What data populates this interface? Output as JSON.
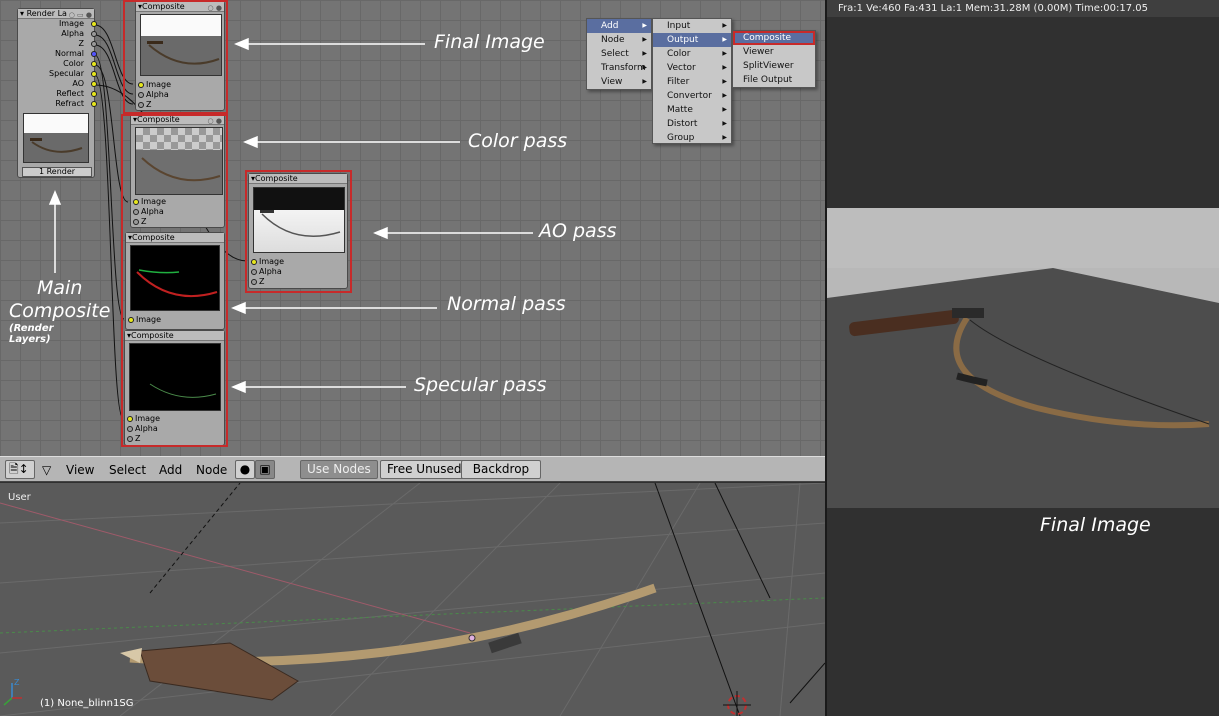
{
  "nodes": {
    "render_layers": {
      "title": "Render La",
      "outputs": [
        "Image",
        "Alpha",
        "Z",
        "Normal",
        "Color",
        "Specular",
        "AO",
        "Reflect",
        "Refract"
      ],
      "layer": "1 Render"
    },
    "composite_title": "Composite",
    "composite_inputs": [
      "Image",
      "Alpha",
      "Z"
    ]
  },
  "annotations": {
    "final_image": "Final Image",
    "color_pass": "Color pass",
    "ao_pass": "AO pass",
    "normal_pass": "Normal pass",
    "specular_pass": "Specular pass",
    "main_composite_1": "Main",
    "main_composite_2": "Composite",
    "render_layers_1": "(Render",
    "render_layers_2": "Layers)"
  },
  "menus": {
    "main": [
      "Add",
      "Node",
      "Select",
      "Transform",
      "View"
    ],
    "add": [
      "Input",
      "Output",
      "Color",
      "Vector",
      "Filter",
      "Convertor",
      "Matte",
      "Distort",
      "Group"
    ],
    "output": [
      "Composite",
      "Viewer",
      "SplitViewer",
      "File Output"
    ]
  },
  "toolbar": {
    "view": "View",
    "select": "Select",
    "add": "Add",
    "node": "Node",
    "use_nodes": "Use Nodes",
    "free_unused": "Free Unused",
    "backdrop": "Backdrop"
  },
  "viewport": {
    "label": "User",
    "object": "(1) None_blinn1SG",
    "axis_z": "Z"
  },
  "render": {
    "status": "Fra:1  Ve:460 Fa:431 La:1 Mem:31.28M (0.00M) Time:00:17.05",
    "caption": "Final Image"
  }
}
